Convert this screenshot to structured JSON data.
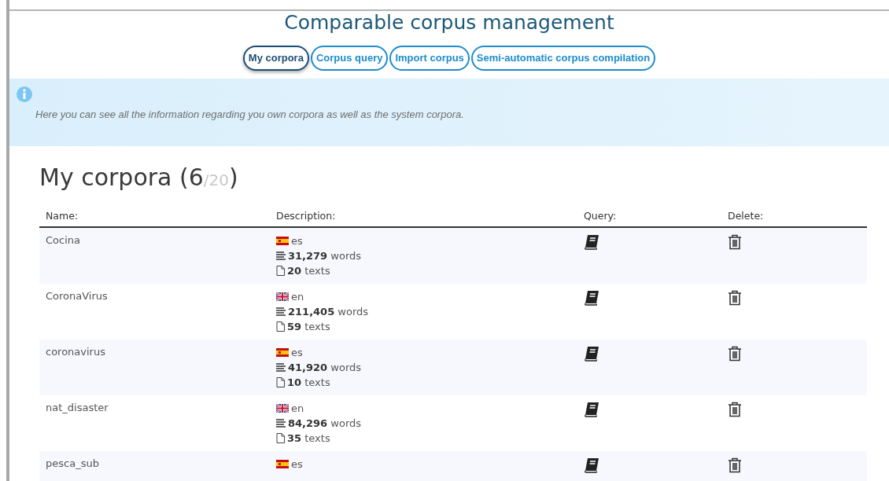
{
  "title": "Comparable corpus management",
  "tabs": [
    {
      "label": "My corpora",
      "selected": true
    },
    {
      "label": "Corpus query",
      "selected": false
    },
    {
      "label": "Import corpus",
      "selected": false
    },
    {
      "label": "Semi-automatic corpus compilation",
      "selected": false
    }
  ],
  "info": {
    "text": "Here you can see all the information regarding you own corpora as well as the system corpora."
  },
  "heading": {
    "text": "My corpora (",
    "count": "6",
    "limit": "/20",
    "close": ")"
  },
  "table": {
    "columns": [
      "Name:",
      "Description:",
      "Query:",
      "Delete:"
    ],
    "rows": [
      {
        "name": "Cocina",
        "kind": "es",
        "language": "es",
        "words": "**31,279** words",
        "texts": "**20** texts"
      },
      {
        "name": "CoronaVirus",
        "kind": "gb",
        "language": "en",
        "words": "**211,405** words",
        "texts": "**59** texts"
      },
      {
        "name": "coronavirus",
        "kind": "es",
        "language": "es",
        "words": "**41,920** words",
        "texts": "**10** texts"
      },
      {
        "name": "nat_disaster",
        "kind": "gb",
        "language": "en",
        "words": "**84,296** words",
        "texts": "**35** texts"
      },
      {
        "name": "pesca_sub",
        "kind": "es",
        "language": "es"
      }
    ]
  }
}
